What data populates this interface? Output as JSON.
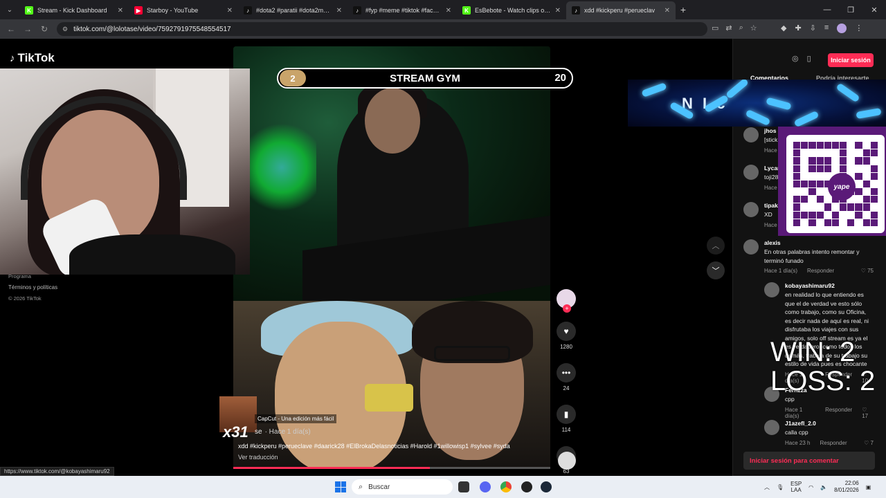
{
  "browser": {
    "tabs": [
      {
        "title": "Stream - Kick Dashboard",
        "fav": "K",
        "fav_color": "#53fc18",
        "active": false
      },
      {
        "title": "Starboy - YouTube",
        "fav": "▶",
        "fav_color": "#ff0033",
        "active": false
      },
      {
        "title": "#dota2 #paratii #dota2memes",
        "fav": "♪",
        "fav_color": "#111111",
        "active": false
      },
      {
        "title": "#fyp #meme #tiktok #faceboo",
        "fav": "♪",
        "fav_color": "#111111",
        "active": false
      },
      {
        "title": "EsBebote - Watch clips on Kick",
        "fav": "K",
        "fav_color": "#53fc18",
        "active": false
      },
      {
        "title": "xdd #kickperu #perueclav",
        "fav": "♪",
        "fav_color": "#111111",
        "active": true
      }
    ],
    "url": "tiktok.com/@lolotase/video/7592791975548554517",
    "status_url": "https://www.tiktok.com/@kobayashimaru92"
  },
  "tiktok": {
    "logo": "TikTok",
    "sidebar_links": [
      "Programa",
      "Términos y políticas",
      "© 2026 TikTok"
    ],
    "login_button": "Iniciar sesión",
    "panel_tabs": [
      "Comentarios",
      "Podría interesarte"
    ],
    "comment_login": "Iniciar sesión para comentar"
  },
  "video": {
    "banner_title": "STREAM GYM",
    "banner_left": "2",
    "banner_right": "20",
    "overlay_x": "x31",
    "capcut_label": "CapCut - Una edición más fácil",
    "author_fragment": "se",
    "time": "· Hace 1 día(s)",
    "description": "xdd #kickperu #perueclave #daarick28 #ElBrokaDelasnoticias #Harold #1willowisp1 #sylvee #syda",
    "translate": "Ver traducción",
    "progress": 0.62,
    "counts": {
      "likes": "1280",
      "comments": "24",
      "saves": "114",
      "shares": "63"
    }
  },
  "overlay": {
    "neon_text": "N I c",
    "win_text": "WIN: 2",
    "loss_text": "LOSS: 2",
    "qr_brand": "yape"
  },
  "comments": [
    {
      "user": "jhos",
      "text": "[stick",
      "meta": "Hace"
    },
    {
      "user": "Lycan",
      "text": "toji28",
      "meta": "Hace"
    },
    {
      "user": "tipak",
      "text": "XD",
      "meta": "Hace"
    },
    {
      "user": "alexis",
      "text": "En otras palabras intento remontar y terminó funado",
      "meta": "Hace 1 día(s)",
      "reply": "Responder",
      "likes": "♡ 75"
    },
    {
      "user": "kobayashimaru92",
      "text": "en realidad lo que entiendo es que el de verdad ve esto sólo como trabajo, como su Oficina, es decir nada de aquí es real, ni disfrutaba los viajes con sus amigos, solo off stream es ya el es verdadero, como todos los demás, trabaja de su trabajo su estilo de vida pues es chocante",
      "meta": "Hace 1 día(s)",
      "reply": "Responder",
      "likes": "♡ 10"
    },
    {
      "user": "Fernzza",
      "text": "cpp",
      "meta": "Hace 1 día(s)",
      "reply": "Responder",
      "likes": "♡ 17"
    },
    {
      "user": "J1azefl_2.0",
      "text": "calla cpp",
      "meta": "Hace 23 h",
      "reply": "Responder",
      "likes": "♡ 7"
    }
  ],
  "taskbar": {
    "search": "Buscar",
    "lang_top": "ESP",
    "lang_bottom": "LAA",
    "time": "22:06",
    "date": "8/01/2026"
  }
}
